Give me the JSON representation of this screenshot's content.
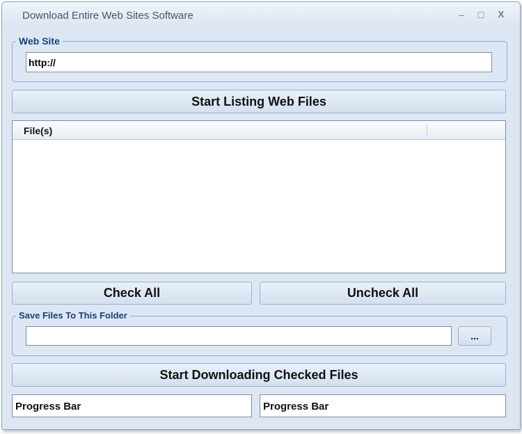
{
  "window": {
    "title": "Download Entire Web Sites Software",
    "minimize_glyph": "–",
    "maximize_glyph": "□",
    "close_glyph": "X"
  },
  "website_group": {
    "label": "Web Site",
    "url_value": "http://"
  },
  "start_listing_button": "Start Listing Web Files",
  "file_list": {
    "columns": [
      "File(s)",
      ""
    ],
    "rows": []
  },
  "check_all_button": "Check All",
  "uncheck_all_button": "Uncheck All",
  "folder_group": {
    "label": "Save Files To This Folder",
    "path_value": "",
    "browse_button": "..."
  },
  "start_download_button": "Start Downloading Checked Files",
  "progress_bars": [
    {
      "label": "Progress Bar"
    },
    {
      "label": "Progress Bar"
    }
  ],
  "colors": {
    "window_background": "#dde7f4",
    "group_label": "#1b3f7a",
    "border": "#8fa9c9"
  }
}
